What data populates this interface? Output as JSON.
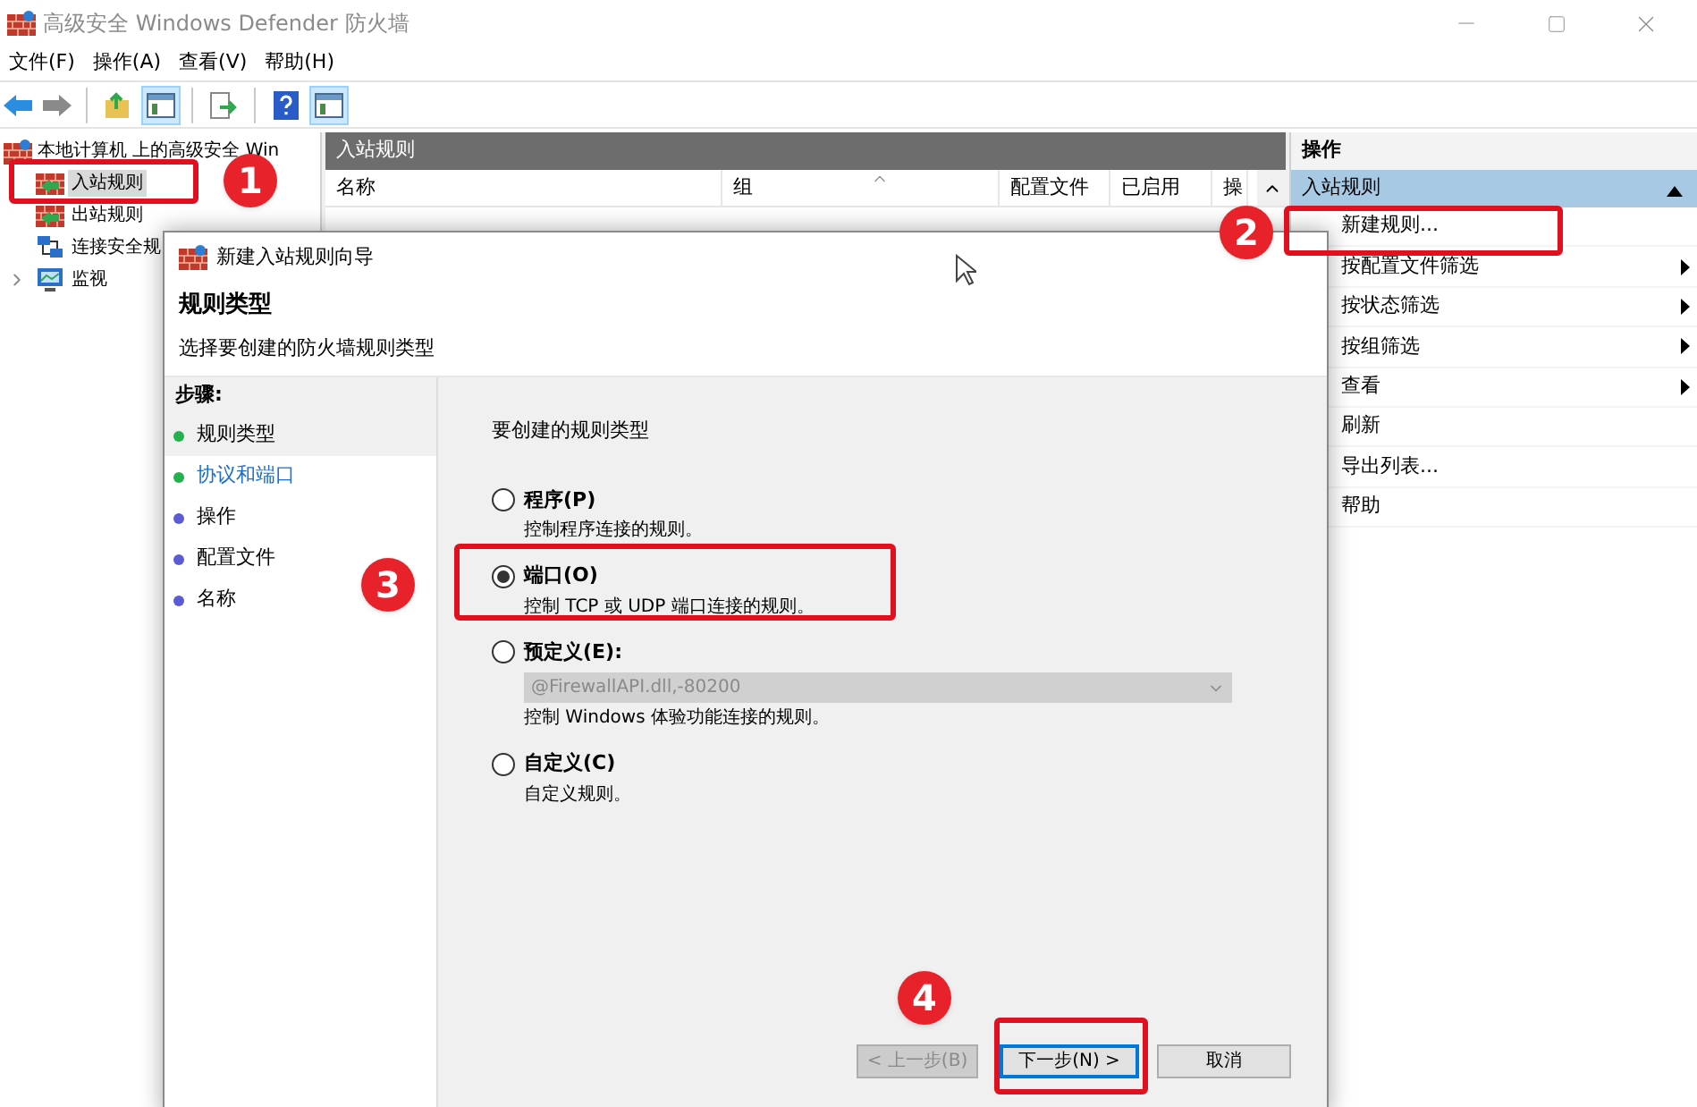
{
  "window": {
    "title": "高级安全 Windows Defender 防火墙"
  },
  "menu": [
    {
      "label": "文件(F)"
    },
    {
      "label": "操作(A)"
    },
    {
      "label": "查看(V)"
    },
    {
      "label": "帮助(H)"
    }
  ],
  "toolbar": [
    {
      "kind": "back"
    },
    {
      "kind": "forward"
    },
    {
      "kind": "sep"
    },
    {
      "kind": "up",
      "selected": false
    },
    {
      "kind": "pane",
      "selected": true
    },
    {
      "kind": "sep"
    },
    {
      "kind": "export",
      "selected": false
    },
    {
      "kind": "sep"
    },
    {
      "kind": "help",
      "selected": false
    },
    {
      "kind": "pane",
      "selected": true
    }
  ],
  "tree": {
    "root": "本地计算机 上的高级安全 Win",
    "children": [
      {
        "label": "入站规则",
        "kind": "inbound",
        "selected": true
      },
      {
        "label": "出站规则",
        "kind": "outbound",
        "selected": false
      },
      {
        "label": "连接安全规",
        "kind": "security",
        "selected": false
      },
      {
        "label": "监视",
        "kind": "monitor",
        "selected": false,
        "expanded": false
      }
    ]
  },
  "center": {
    "title": "入站规则",
    "columns": [
      "名称",
      "组",
      "配置文件",
      "已启用",
      "操"
    ]
  },
  "actions": {
    "title": "操作",
    "section": {
      "label": "入站规则",
      "expanded": true
    },
    "items": [
      {
        "label": "新建规则...",
        "submenu": false
      },
      {
        "label": "按配置文件筛选",
        "submenu": true
      },
      {
        "label": "按状态筛选",
        "submenu": true
      },
      {
        "label": "按组筛选",
        "submenu": true
      },
      {
        "label": "查看",
        "submenu": true
      },
      {
        "label": "刷新",
        "submenu": false
      },
      {
        "label": "导出列表...",
        "submenu": false
      },
      {
        "label": "帮助",
        "submenu": false
      }
    ]
  },
  "dialog": {
    "title": "新建入站规则向导",
    "heading": "规则类型",
    "subtitle": "选择要创建的防火墙规则类型",
    "steps_title": "步骤:",
    "steps": [
      {
        "label": "规则类型",
        "color": "#22b14c",
        "selected": true,
        "kind": "plain"
      },
      {
        "label": "协议和端口",
        "color": "#22b14c",
        "selected": false,
        "kind": "link"
      },
      {
        "label": "操作",
        "color": "#5b5bd6",
        "selected": false,
        "kind": "plain"
      },
      {
        "label": "配置文件",
        "color": "#5b5bd6",
        "selected": false,
        "kind": "plain"
      },
      {
        "label": "名称",
        "color": "#5b5bd6",
        "selected": false,
        "kind": "plain"
      }
    ],
    "prompt": "要创建的规则类型",
    "options": [
      {
        "label": "程序(P)",
        "description": "控制程序连接的规则。",
        "selected": false
      },
      {
        "label": "端口(O)",
        "description": "控制 TCP 或 UDP 端口连接的规则。",
        "selected": true
      },
      {
        "label": "预定义(E):",
        "dropdown": {
          "value": "@FirewallAPI.dll,-80200",
          "disabled": true
        },
        "description": "控制 Windows 体验功能连接的规则。",
        "selected": false
      },
      {
        "label": "自定义(C)",
        "description": "自定义规则。",
        "selected": false
      }
    ],
    "buttons": [
      {
        "label": "< 上一步(B)",
        "disabled": true,
        "default": false
      },
      {
        "label": "下一步(N) >",
        "disabled": false,
        "default": true
      },
      {
        "label": "取消",
        "disabled": false,
        "default": false
      }
    ]
  },
  "callouts": [
    {
      "number": "1"
    },
    {
      "number": "2"
    },
    {
      "number": "3"
    },
    {
      "number": "4"
    }
  ]
}
